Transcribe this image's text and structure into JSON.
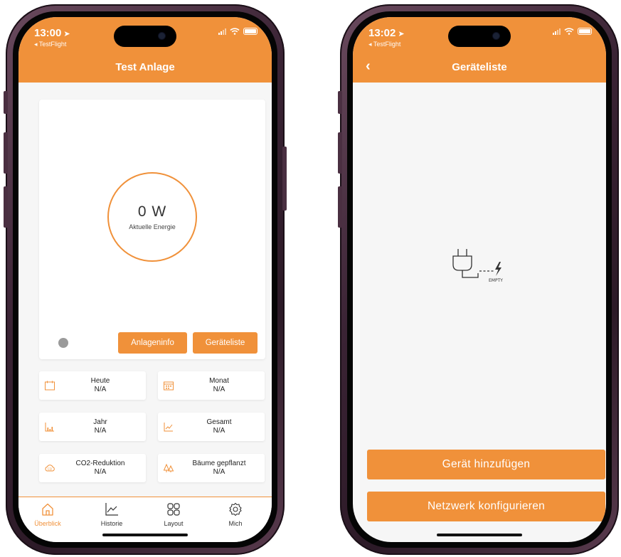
{
  "left_screen": {
    "status": {
      "time": "13:00",
      "back_app": "◂ TestFlight"
    },
    "header": {
      "title": "Test Anlage"
    },
    "energy": {
      "value": "0 W",
      "label": "Aktuelle Energie"
    },
    "buttons": {
      "info": "Anlageninfo",
      "device_list": "Geräteliste"
    },
    "stats": [
      {
        "title": "Heute",
        "value": "N/A",
        "icon": "calendar-day-icon"
      },
      {
        "title": "Monat",
        "value": "N/A",
        "icon": "calendar-month-icon"
      },
      {
        "title": "Jahr",
        "value": "N/A",
        "icon": "bar-chart-icon"
      },
      {
        "title": "Gesamt",
        "value": "N/A",
        "icon": "trend-up-icon"
      },
      {
        "title": "CO2-Reduktion",
        "value": "N/A",
        "icon": "co2-cloud-icon"
      },
      {
        "title": "Bäume gepflanzt",
        "value": "N/A",
        "icon": "trees-icon"
      }
    ],
    "tabs": [
      {
        "label": "Überblick",
        "icon": "home-icon",
        "active": true
      },
      {
        "label": "Historie",
        "icon": "line-chart-icon",
        "active": false
      },
      {
        "label": "Layout",
        "icon": "grid-icon",
        "active": false
      },
      {
        "label": "Mich",
        "icon": "settings-gear-icon",
        "active": false
      }
    ]
  },
  "right_screen": {
    "status": {
      "time": "13:02",
      "back_app": "◂ TestFlight"
    },
    "header": {
      "title": "Geräteliste"
    },
    "empty_state": {
      "label": "EMPTY",
      "icon": "plug-empty-icon"
    },
    "buttons": {
      "add_device": "Gerät hinzufügen",
      "configure_network": "Netzwerk konfigurieren"
    }
  },
  "colors": {
    "accent": "#f0913a",
    "background": "#f6f6f6",
    "card": "#ffffff",
    "status_dot": "#9a9a9a"
  }
}
